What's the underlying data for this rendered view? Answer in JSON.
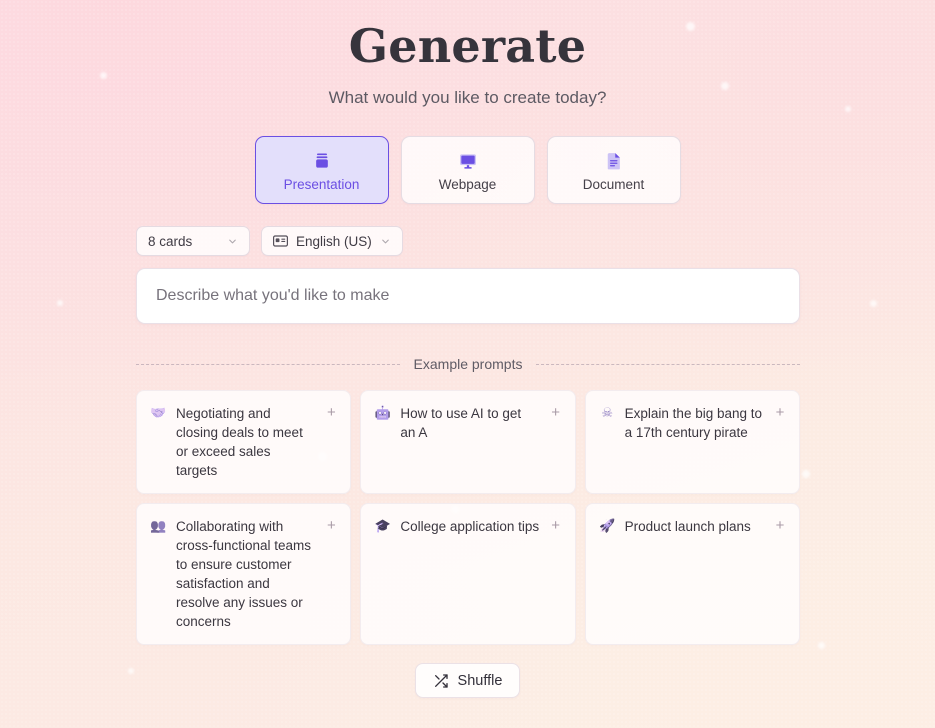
{
  "header": {
    "title": "Generate",
    "subtitle": "What would you like to create today?"
  },
  "type_selector": {
    "items": [
      {
        "label": "Presentation",
        "icon": "presentation-icon",
        "selected": true
      },
      {
        "label": "Webpage",
        "icon": "monitor-icon",
        "selected": false
      },
      {
        "label": "Document",
        "icon": "document-icon",
        "selected": false
      }
    ]
  },
  "options": {
    "card_count": {
      "value": "8 cards",
      "icon": "chevron-down-icon"
    },
    "language": {
      "value": "English (US)",
      "icon": "language-card-icon",
      "chevron": "chevron-down-icon"
    }
  },
  "prompt": {
    "placeholder": "Describe what you'd like to make",
    "value": ""
  },
  "examples": {
    "divider_label": "Example prompts",
    "add_glyph": "+",
    "cards": [
      {
        "emoji": "🤝",
        "icon_name": "handshake-emoji",
        "text": "Negotiating and closing deals to meet or exceed sales targets"
      },
      {
        "emoji": "🤖",
        "icon_name": "robot-emoji",
        "text": "How to use AI to get an A"
      },
      {
        "emoji": "☠",
        "icon_name": "skull-crossbones-emoji",
        "text": "Explain the big bang to a 17th century pirate"
      },
      {
        "emoji": "👥",
        "icon_name": "people-emoji",
        "text": "Collaborating with cross-functional teams to ensure customer satisfaction and resolve any issues or concerns"
      },
      {
        "emoji": "🎓",
        "icon_name": "graduation-cap-emoji",
        "text": "College application tips"
      },
      {
        "emoji": "🚀",
        "icon_name": "rocket-emoji",
        "text": "Product launch plans"
      }
    ]
  },
  "shuffle": {
    "label": "Shuffle",
    "icon": "shuffle-icon"
  },
  "colors": {
    "accent_purple": "#6b4fe3",
    "selected_fill": "#e3dffb",
    "text_primary": "#36343c",
    "text_secondary": "#5d5a63",
    "bg_pink": "#fde0e5",
    "bg_cream": "#fcefe7"
  }
}
